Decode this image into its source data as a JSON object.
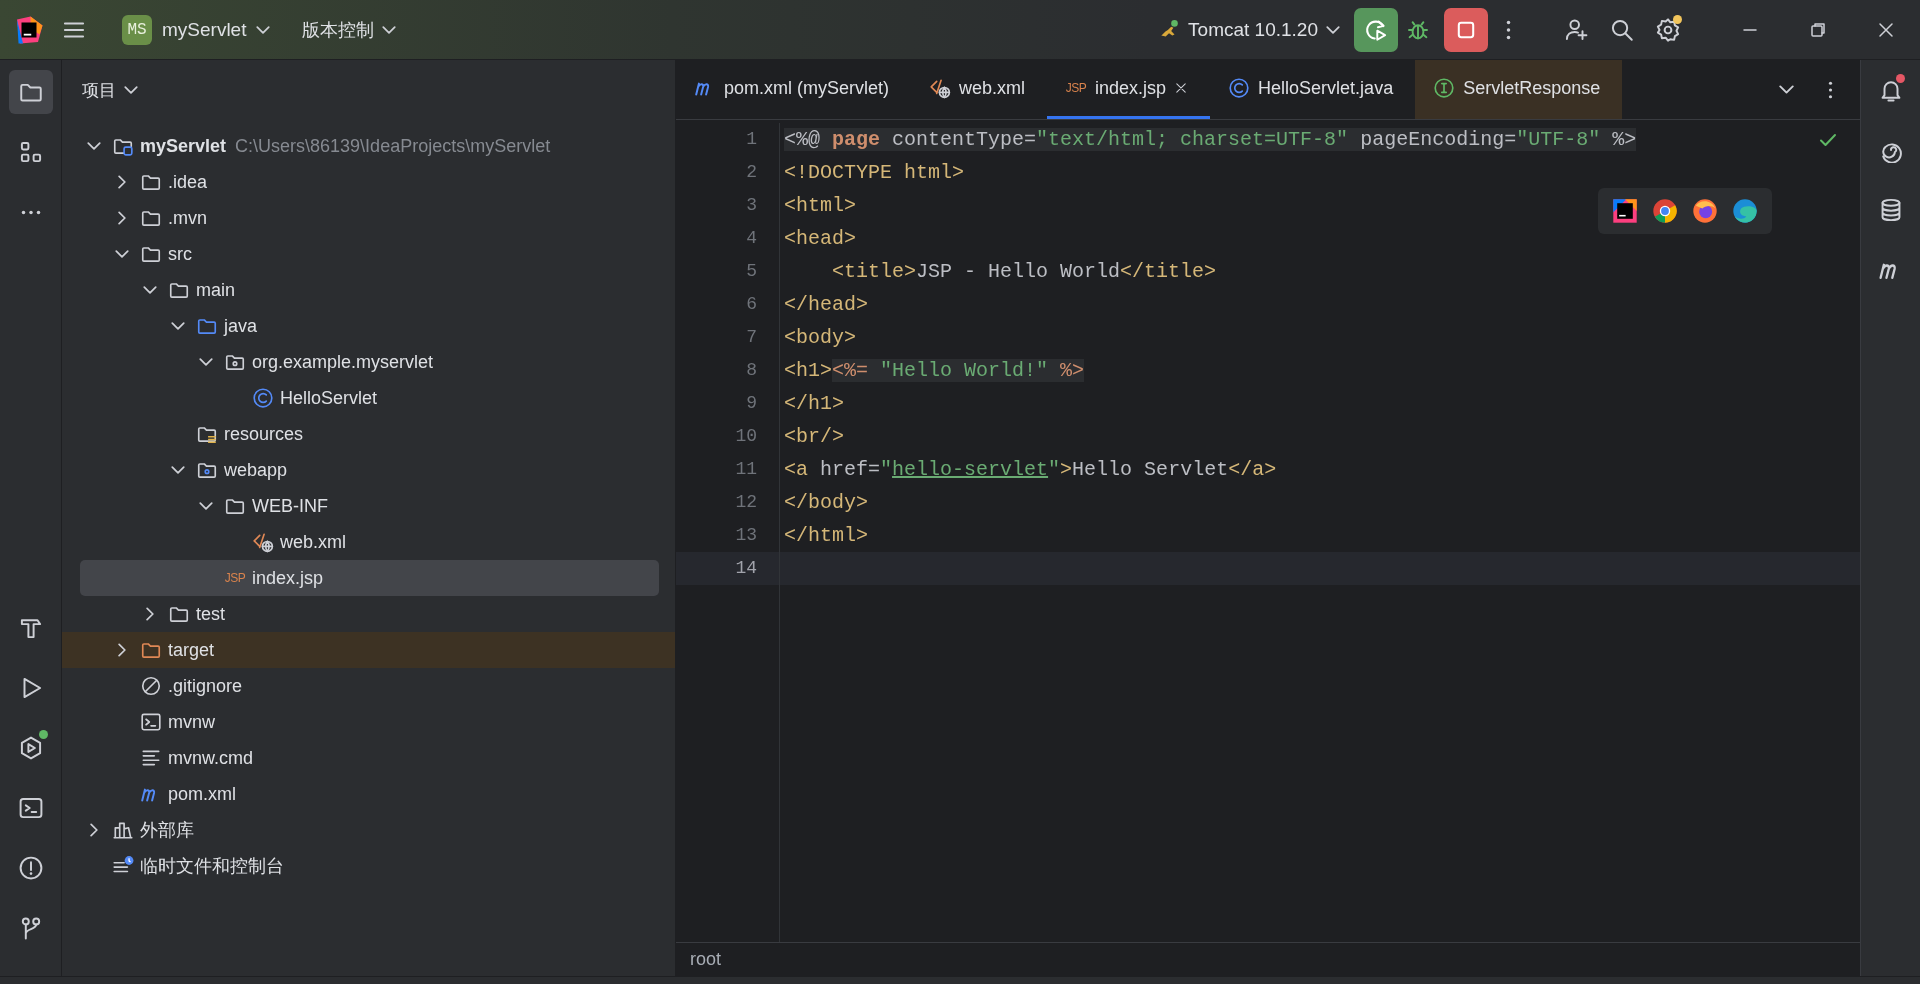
{
  "title_bar": {
    "project_badge": "MS",
    "project": "myServlet",
    "vcs": "版本控制",
    "run_config": "Tomcat 10.1.20",
    "settings_update": true
  },
  "left_tools": [
    {
      "kind": "project",
      "selected": true
    },
    {
      "kind": "structure",
      "selected": false
    },
    {
      "kind": "more",
      "selected": false
    },
    {
      "kind": "build",
      "selected": false
    },
    {
      "kind": "run",
      "selected": false
    },
    {
      "kind": "services",
      "selected": false,
      "running": true
    },
    {
      "kind": "terminal",
      "selected": false
    },
    {
      "kind": "problems",
      "selected": false
    },
    {
      "kind": "git",
      "selected": false
    }
  ],
  "right_tools": [
    {
      "kind": "notifications",
      "unread": true
    },
    {
      "kind": "assistant",
      "unread": false
    },
    {
      "kind": "database",
      "unread": false
    },
    {
      "kind": "maven",
      "unread": false
    }
  ],
  "project_panel": {
    "title": "项目",
    "tree": [
      {
        "label": "myServlet",
        "kind": "module",
        "path": "C:\\Users\\86139\\IdeaProjects\\myServlet",
        "expanded": true,
        "selected": false,
        "children": [
          {
            "label": ".idea",
            "kind": "folder",
            "expanded": false,
            "selected": false
          },
          {
            "label": ".mvn",
            "kind": "folder",
            "expanded": false,
            "selected": false
          },
          {
            "label": "src",
            "kind": "folder",
            "expanded": true,
            "selected": false,
            "children": [
              {
                "label": "main",
                "kind": "folder",
                "expanded": true,
                "selected": false,
                "children": [
                  {
                    "label": "java",
                    "kind": "source",
                    "expanded": true,
                    "selected": false,
                    "children": [
                      {
                        "label": "org.example.myservlet",
                        "kind": "package",
                        "expanded": true,
                        "selected": false,
                        "children": [
                          {
                            "label": "HelloServlet",
                            "kind": "class",
                            "selected": false
                          }
                        ]
                      }
                    ]
                  },
                  {
                    "label": "resources",
                    "kind": "resources",
                    "selected": false
                  },
                  {
                    "label": "webapp",
                    "kind": "web",
                    "expanded": true,
                    "selected": false,
                    "children": [
                      {
                        "label": "WEB-INF",
                        "kind": "folder",
                        "expanded": true,
                        "selected": false,
                        "children": [
                          {
                            "label": "web.xml",
                            "kind": "xml",
                            "selected": false
                          }
                        ]
                      },
                      {
                        "label": "index.jsp",
                        "kind": "jsp",
                        "badge": "JSP",
                        "selected": true
                      }
                    ]
                  }
                ]
              },
              {
                "label": "test",
                "kind": "folder",
                "expanded": false,
                "selected": false
              }
            ]
          },
          {
            "label": "target",
            "kind": "excluded",
            "expanded": false,
            "selected": false
          },
          {
            "label": ".gitignore",
            "kind": "ignore",
            "selected": false
          },
          {
            "label": "mvnw",
            "kind": "shell",
            "selected": false
          },
          {
            "label": "mvnw.cmd",
            "kind": "text",
            "selected": false
          },
          {
            "label": "pom.xml",
            "kind": "maven",
            "selected": false
          }
        ]
      },
      {
        "label": "外部库",
        "kind": "library",
        "expanded": false,
        "selected": false
      },
      {
        "label": "临时文件和控制台",
        "kind": "scratch",
        "selected": false
      }
    ]
  },
  "editor": {
    "tabs": [
      {
        "label": "pom.xml (myServlet)",
        "kind": "maven",
        "selected": false
      },
      {
        "label": "web.xml",
        "kind": "xml",
        "selected": false
      },
      {
        "label": "index.jsp",
        "kind": "jsp",
        "badge": "JSP",
        "selected": true
      },
      {
        "label": "HelloServlet.java",
        "kind": "class",
        "selected": false
      },
      {
        "label": "ServletResponse",
        "kind": "interface",
        "selected": false,
        "color": "#3a3024"
      }
    ],
    "no_problems": true,
    "lines": [
      {
        "number": "1",
        "current": false,
        "tokens": [
          {
            "text": "<%@",
            "kind": "plain",
            "embedded": true
          },
          {
            "text": " page",
            "kind": "keyword",
            "embedded": true
          },
          {
            "text": " contentType=",
            "kind": "plain",
            "embedded": true
          },
          {
            "text": "\"text/html; charset=UTF-8\"",
            "kind": "string",
            "embedded": true
          },
          {
            "text": " pageEncoding=",
            "kind": "plain",
            "embedded": true
          },
          {
            "text": "\"UTF-8\"",
            "kind": "string",
            "embedded": true
          },
          {
            "text": " %>",
            "kind": "plain",
            "embedded": true
          }
        ]
      },
      {
        "number": "2",
        "current": false,
        "tokens": [
          {
            "text": "<!DOCTYPE html>",
            "kind": "tag"
          }
        ]
      },
      {
        "number": "3",
        "current": false,
        "tokens": [
          {
            "text": "<html>",
            "kind": "tag"
          }
        ]
      },
      {
        "number": "4",
        "current": false,
        "tokens": [
          {
            "text": "<head>",
            "kind": "tag"
          }
        ]
      },
      {
        "number": "5",
        "current": false,
        "tokens": [
          {
            "text": "    <title>",
            "kind": "tag"
          },
          {
            "text": "JSP - Hello World",
            "kind": "plain"
          },
          {
            "text": "</title>",
            "kind": "tag"
          }
        ]
      },
      {
        "number": "6",
        "current": false,
        "tokens": [
          {
            "text": "</head>",
            "kind": "tag"
          }
        ]
      },
      {
        "number": "7",
        "current": false,
        "tokens": [
          {
            "text": "<body>",
            "kind": "tag"
          }
        ]
      },
      {
        "number": "8",
        "current": false,
        "tokens": [
          {
            "text": "<h1>",
            "kind": "tag"
          },
          {
            "text": "<%=",
            "kind": "delim",
            "embedded": true
          },
          {
            "text": " \"Hello World!\" ",
            "kind": "string",
            "embedded": true
          },
          {
            "text": "%>",
            "kind": "delim",
            "embedded": true
          }
        ]
      },
      {
        "number": "9",
        "current": false,
        "tokens": [
          {
            "text": "</h1>",
            "kind": "tag"
          }
        ]
      },
      {
        "number": "10",
        "current": false,
        "tokens": [
          {
            "text": "<br/>",
            "kind": "tag"
          }
        ]
      },
      {
        "number": "11",
        "current": false,
        "tokens": [
          {
            "text": "<a",
            "kind": "tag"
          },
          {
            "text": " href=",
            "kind": "plain"
          },
          {
            "text": "\"",
            "kind": "string"
          },
          {
            "text": "hello-servlet",
            "kind": "link"
          },
          {
            "text": "\"",
            "kind": "string"
          },
          {
            "text": ">",
            "kind": "tag"
          },
          {
            "text": "Hello Servlet",
            "kind": "plain"
          },
          {
            "text": "</a>",
            "kind": "tag"
          }
        ]
      },
      {
        "number": "12",
        "current": false,
        "tokens": [
          {
            "text": "</body>",
            "kind": "tag"
          }
        ]
      },
      {
        "number": "13",
        "current": false,
        "tokens": [
          {
            "text": "</html>",
            "kind": "tag"
          }
        ]
      },
      {
        "number": "14",
        "current": true
      }
    ],
    "browsers": [
      {
        "kind": "ide"
      },
      {
        "kind": "chrome"
      },
      {
        "kind": "firefox"
      },
      {
        "kind": "edge"
      }
    ],
    "breadcrumb": "root"
  }
}
